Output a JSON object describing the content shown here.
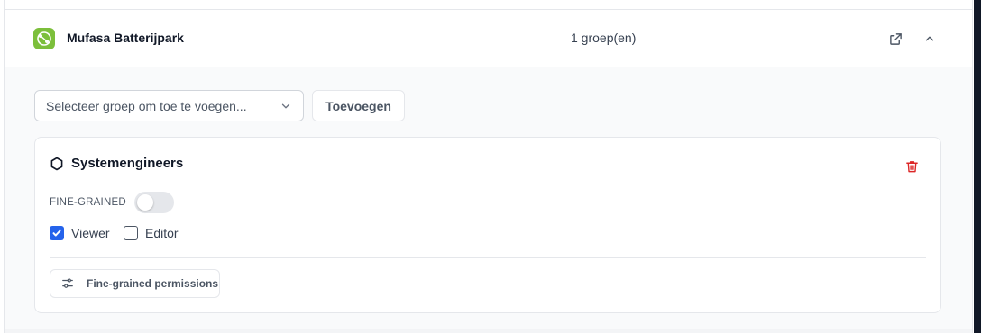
{
  "project": {
    "name": "Mufasa Batterijpark",
    "group_count_text": "1 groep(en)",
    "logo_icon": "mufasa-logo-icon",
    "logo_color": "#7cbf3b",
    "open_icon": "external-link-icon",
    "collapse_icon": "chevron-up-icon"
  },
  "add_group": {
    "select_placeholder": "Selecteer groep om toe te voegen...",
    "select_icon": "chevron-down-icon",
    "add_label": "Toevoegen"
  },
  "group": {
    "title": "Systemengineers",
    "title_icon": "hexagon-icon",
    "delete_icon": "trash-icon",
    "delete_color": "#dc2626",
    "fine_grained_label": "FINE-GRAINED",
    "fine_grained_enabled": false,
    "permissions": [
      {
        "label": "Viewer",
        "checked": true
      },
      {
        "label": "Editor",
        "checked": false
      }
    ],
    "fine_grained_button_label": "Fine-grained permissions",
    "fine_grained_button_icon": "sliders-icon",
    "accent_color": "#2563eb"
  }
}
